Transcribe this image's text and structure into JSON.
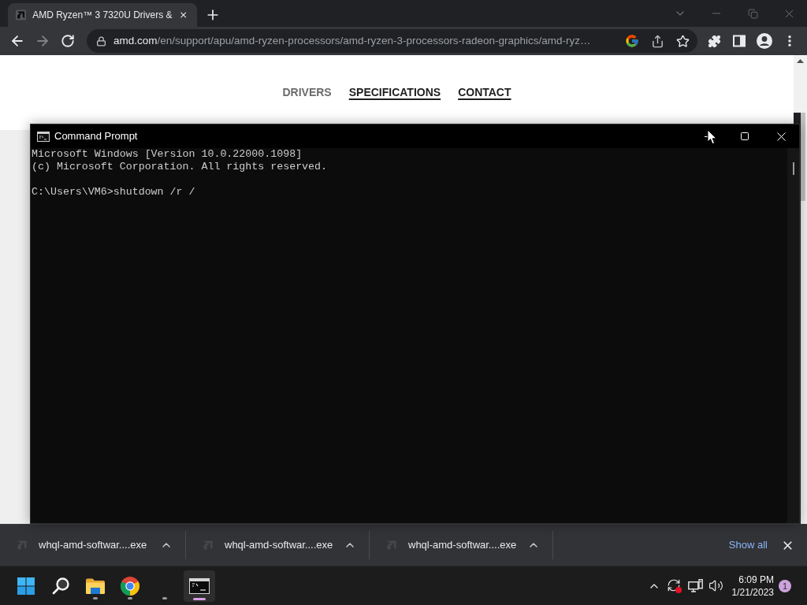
{
  "browser": {
    "tabs": [
      {
        "title": "AMD Ryzen™ 3 7320U Drivers &",
        "selected": true
      }
    ],
    "nav_buttons": [
      {
        "kind": "back",
        "disabled": false
      },
      {
        "kind": "forward",
        "disabled": true
      },
      {
        "kind": "reload",
        "disabled": false
      }
    ],
    "address_bar": {
      "domain": "amd.com",
      "path": "/en/support/apu/amd-ryzen-processors/amd-ryzen-3-processors-radeon-graphics/amd-ryz…"
    }
  },
  "page": {
    "nav_links": [
      {
        "label": "DRIVERS",
        "selected": true
      },
      {
        "label": "SPECIFICATIONS",
        "selected": false
      },
      {
        "label": "CONTACT",
        "selected": false
      }
    ]
  },
  "command_prompt": {
    "title": "Command Prompt",
    "output_lines": [
      "Microsoft Windows [Version 10.0.22000.1098]",
      "(c) Microsoft Corporation. All rights reserved."
    ],
    "command_line": "C:\\Users\\VM6>shutdown /r /"
  },
  "downloads": {
    "items": [
      {
        "filename": "whql-amd-softwar....exe"
      },
      {
        "filename": "whql-amd-softwar....exe"
      },
      {
        "filename": "whql-amd-softwar....exe"
      }
    ],
    "show_all": "Show all"
  },
  "taskbar": {
    "apps": [
      {
        "kind": "start",
        "running": false,
        "selected": false
      },
      {
        "kind": "search",
        "running": false,
        "selected": false
      },
      {
        "kind": "explorer",
        "running": true,
        "selected": false
      },
      {
        "kind": "chrome",
        "running": true,
        "selected": false
      },
      {
        "kind": "blank",
        "running": true,
        "selected": false
      },
      {
        "kind": "terminal",
        "running": true,
        "selected": true
      }
    ],
    "clock": {
      "time": "6:09 PM",
      "date": "1/21/2023"
    },
    "notification_count": "1"
  }
}
